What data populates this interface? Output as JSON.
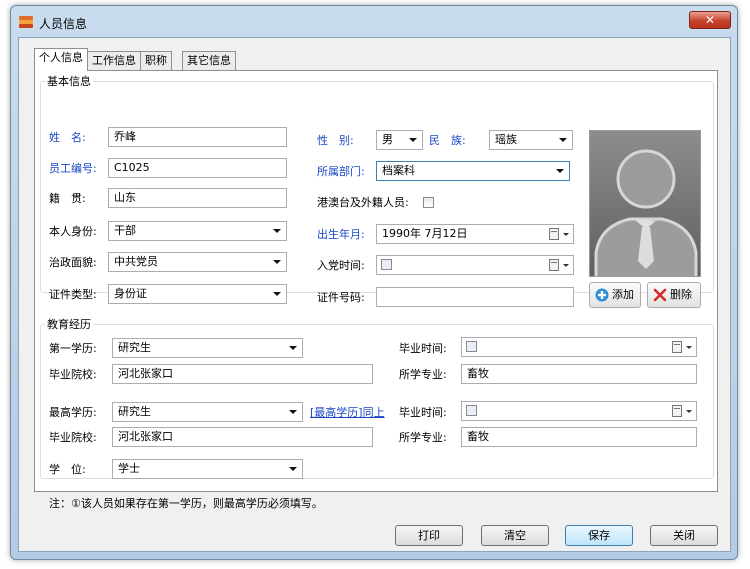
{
  "window": {
    "title": "人员信息",
    "close_label": "✕"
  },
  "tabs": [
    "个人信息",
    "工作信息",
    "职称",
    "其它信息"
  ],
  "basic": {
    "legend": "基本信息",
    "name": {
      "label": "姓　名:",
      "value": "乔峰"
    },
    "gender": {
      "label": "性　别:",
      "value": "男"
    },
    "ethnicity": {
      "label": "民　族:",
      "value": "瑶族"
    },
    "employee_no": {
      "label": "员工编号:",
      "value": "C1025"
    },
    "department": {
      "label": "所属部门:",
      "value": "档案科"
    },
    "native_place": {
      "label": "籍　贯:",
      "value": "山东"
    },
    "overseas": {
      "label": "港澳台及外籍人员:"
    },
    "identity": {
      "label": "本人身份:",
      "value": "干部"
    },
    "birth": {
      "label": "出生年月:",
      "value": "1990年  7月12日"
    },
    "political": {
      "label": "治政面貌:",
      "value": "中共党员"
    },
    "party_date": {
      "label": "入党时间:"
    },
    "id_type": {
      "label": "证件类型:",
      "value": "身份证"
    },
    "id_no": {
      "label": "证件号码:",
      "value": ""
    },
    "photo_add": "添加",
    "photo_delete": "删除"
  },
  "education": {
    "legend": "教育经历",
    "first_degree": {
      "label": "第一学历:",
      "value": "研究生"
    },
    "first_grad_time": {
      "label": "毕业时间:"
    },
    "first_school": {
      "label": "毕业院校:",
      "value": "河北张家口"
    },
    "first_major": {
      "label": "所学专业:",
      "value": "畜牧"
    },
    "highest_degree": {
      "label": "最高学历:",
      "value": "研究生"
    },
    "same_link": "[最高学历]同上",
    "highest_grad_time": {
      "label": "毕业时间:"
    },
    "highest_school": {
      "label": "毕业院校:",
      "value": "河北张家口"
    },
    "highest_major": {
      "label": "所学专业:",
      "value": "畜牧"
    },
    "academic_degree": {
      "label": "学　位:",
      "value": "学士"
    },
    "note": "注：①该人员如果存在第一学历，则最高学历必须填写。"
  },
  "footer": {
    "print": "打印",
    "clear": "清空",
    "save": "保存",
    "close": "关闭"
  }
}
